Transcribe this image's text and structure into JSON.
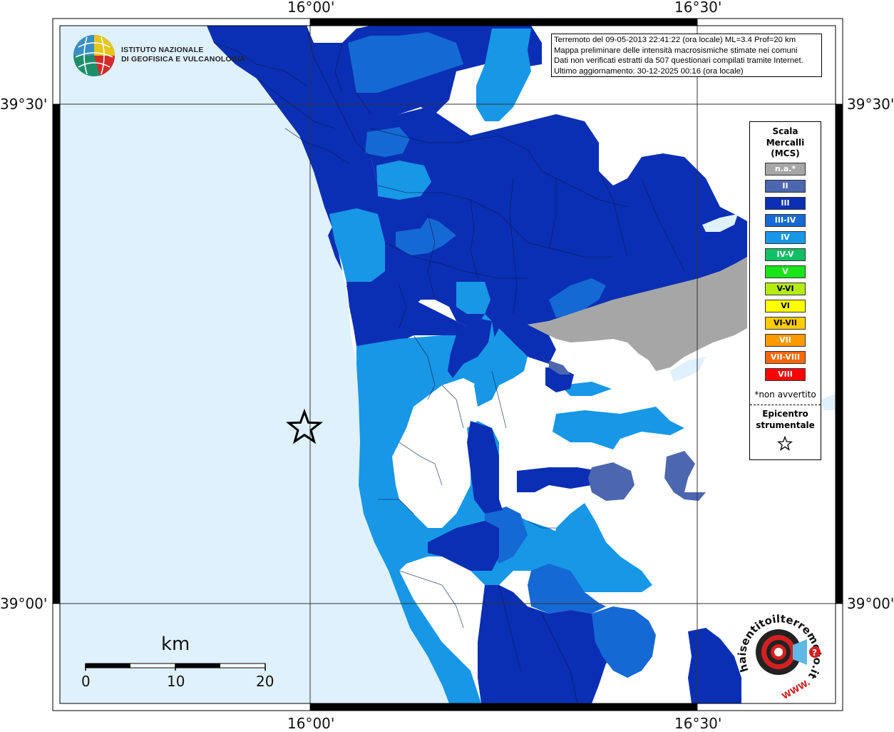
{
  "info": {
    "line1": "Terremoto del 09-05-2013 22:41:22 (ora locale) ML=3.4 Prof=20 km",
    "line2": "Mappa preliminare delle intensità macrosismiche stimate nei comuni",
    "line3": "Dati non verificati estratti da 507 questionari compilati tramite Internet.",
    "line4": "Ultimo aggiornamento: 30-12-2025 00:16 (ora locale)"
  },
  "logo": {
    "line1": "ISTITUTO NAZIONALE",
    "line2": "DI GEOFISICA E VULCANOLOGIA"
  },
  "coords": {
    "top_left": "16°00'",
    "top_right": "16°30'",
    "bottom_left": "16°00'",
    "bottom_right": "16°30'",
    "left_upper": "39°30'",
    "left_lower": "39°00'",
    "right_upper": "39°30'",
    "right_lower": "39°00'"
  },
  "legend": {
    "title1": "Scala",
    "title2": "Mercalli",
    "title3": "(MCS)",
    "classes": [
      {
        "label": "n.a.*",
        "color": "#a6a6a6"
      },
      {
        "label": "II",
        "color": "#4c66b0"
      },
      {
        "label": "III",
        "color": "#0a2fb4"
      },
      {
        "label": "III-IV",
        "color": "#1569d4"
      },
      {
        "label": "IV",
        "color": "#1797e6"
      },
      {
        "label": "IV-V",
        "color": "#11c066"
      },
      {
        "label": "V",
        "color": "#19e419"
      },
      {
        "label": "V-VI",
        "color": "#b4ec10"
      },
      {
        "label": "VI",
        "color": "#ffff00"
      },
      {
        "label": "VI-VII",
        "color": "#ffcc00"
      },
      {
        "label": "VII",
        "color": "#ff9900"
      },
      {
        "label": "VII-VIII",
        "color": "#ff6600"
      },
      {
        "label": "VIII",
        "color": "#ff0000"
      }
    ],
    "not_felt": "*non avvertito",
    "epicenter1": "Epicentro",
    "epicenter2": "strumentale"
  },
  "scalebar": {
    "unit": "km",
    "ticks": [
      "0",
      "10",
      "20"
    ]
  },
  "colors": {
    "sea": "#dff1fc",
    "land_no_data": "#ffffff",
    "mcs_II": "#4c66b0",
    "mcs_III": "#0a2fb4",
    "mcs_III_IV": "#1569d4",
    "mcs_IV": "#1797e6",
    "na": "#a6a6a6"
  },
  "badge": {
    "text": "haisentitoilterremoto.it",
    "url": "WWW."
  }
}
